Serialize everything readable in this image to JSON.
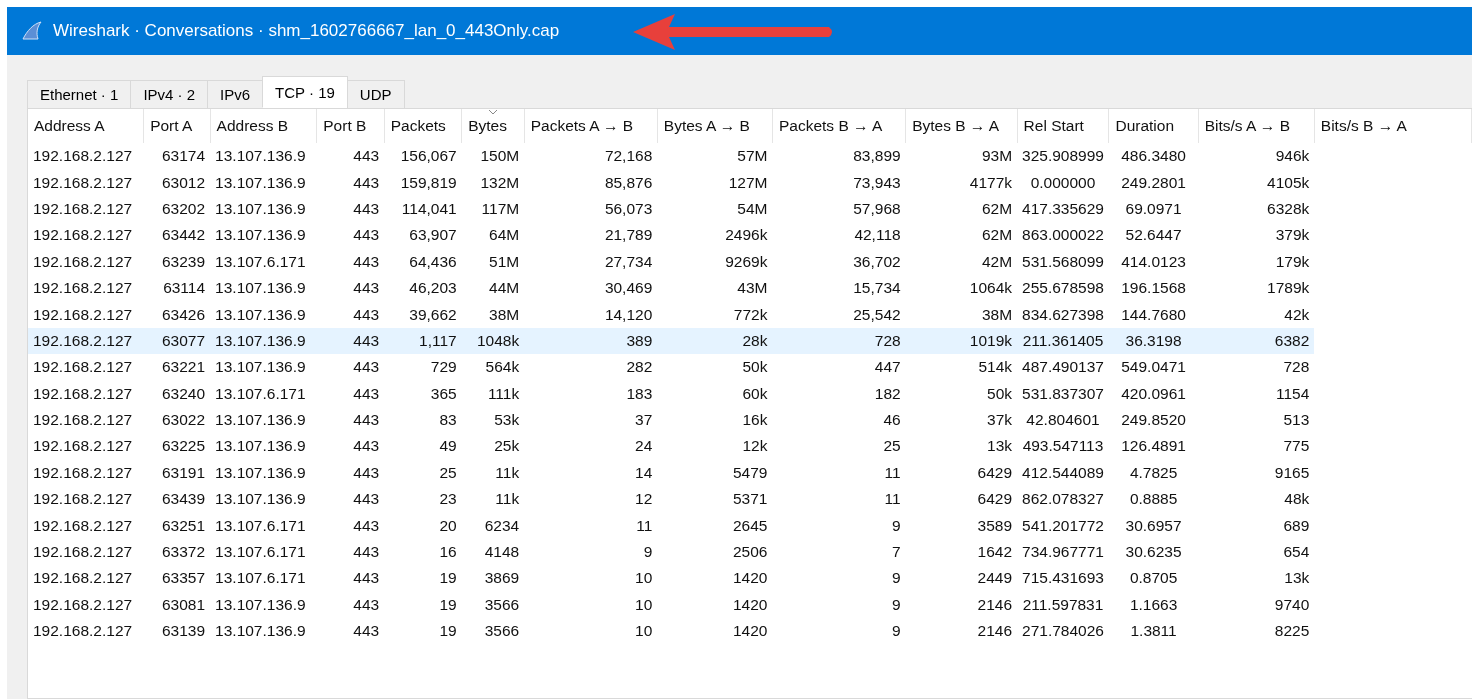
{
  "window": {
    "title": "Wireshark · Conversations · shm_1602766667_lan_0_443Only.cap"
  },
  "tabs": [
    {
      "label": "Ethernet · 1",
      "selected": false
    },
    {
      "label": "IPv4 · 2",
      "selected": false
    },
    {
      "label": "IPv6",
      "selected": false
    },
    {
      "label": "TCP · 19",
      "selected": true
    },
    {
      "label": "UDP",
      "selected": false
    }
  ],
  "table": {
    "columns": [
      {
        "label": "Address A",
        "sorted": false,
        "kind": "address"
      },
      {
        "label": "Port A",
        "sorted": false,
        "kind": "number"
      },
      {
        "label": "Address B",
        "sorted": false,
        "kind": "address"
      },
      {
        "label": "Port B",
        "sorted": false,
        "kind": "number"
      },
      {
        "label": "Packets",
        "sorted": false,
        "kind": "number"
      },
      {
        "label": "Bytes",
        "sorted": true,
        "kind": "number"
      },
      {
        "label": "Packets A → B",
        "sorted": false,
        "kind": "number"
      },
      {
        "label": "Bytes A → B",
        "sorted": false,
        "kind": "number"
      },
      {
        "label": "Packets B → A",
        "sorted": false,
        "kind": "number"
      },
      {
        "label": "Bytes B → A",
        "sorted": false,
        "kind": "number"
      },
      {
        "label": "Rel Start",
        "sorted": false,
        "kind": "time"
      },
      {
        "label": "Duration",
        "sorted": false,
        "kind": "time"
      },
      {
        "label": "Bits/s A → B",
        "sorted": false,
        "kind": "number"
      },
      {
        "label": "Bits/s B → A",
        "sorted": false,
        "kind": "number"
      }
    ],
    "rows": [
      {
        "highlighted": false,
        "cells": [
          "192.168.2.127",
          "63174",
          "13.107.136.9",
          "443",
          "156,067",
          "150M",
          "72,168",
          "57M",
          "83,899",
          "93M",
          "325.908999",
          "486.3480",
          "946k"
        ]
      },
      {
        "highlighted": false,
        "cells": [
          "192.168.2.127",
          "63012",
          "13.107.136.9",
          "443",
          "159,819",
          "132M",
          "85,876",
          "127M",
          "73,943",
          "4177k",
          "0.000000",
          "249.2801",
          "4105k"
        ]
      },
      {
        "highlighted": false,
        "cells": [
          "192.168.2.127",
          "63202",
          "13.107.136.9",
          "443",
          "114,041",
          "117M",
          "56,073",
          "54M",
          "57,968",
          "62M",
          "417.335629",
          "69.0971",
          "6328k"
        ]
      },
      {
        "highlighted": false,
        "cells": [
          "192.168.2.127",
          "63442",
          "13.107.136.9",
          "443",
          "63,907",
          "64M",
          "21,789",
          "2496k",
          "42,118",
          "62M",
          "863.000022",
          "52.6447",
          "379k"
        ]
      },
      {
        "highlighted": false,
        "cells": [
          "192.168.2.127",
          "63239",
          "13.107.6.171",
          "443",
          "64,436",
          "51M",
          "27,734",
          "9269k",
          "36,702",
          "42M",
          "531.568099",
          "414.0123",
          "179k"
        ]
      },
      {
        "highlighted": false,
        "cells": [
          "192.168.2.127",
          "63114",
          "13.107.136.9",
          "443",
          "46,203",
          "44M",
          "30,469",
          "43M",
          "15,734",
          "1064k",
          "255.678598",
          "196.1568",
          "1789k"
        ]
      },
      {
        "highlighted": false,
        "cells": [
          "192.168.2.127",
          "63426",
          "13.107.136.9",
          "443",
          "39,662",
          "38M",
          "14,120",
          "772k",
          "25,542",
          "38M",
          "834.627398",
          "144.7680",
          "42k"
        ]
      },
      {
        "highlighted": true,
        "cells": [
          "192.168.2.127",
          "63077",
          "13.107.136.9",
          "443",
          "1,117",
          "1048k",
          "389",
          "28k",
          "728",
          "1019k",
          "211.361405",
          "36.3198",
          "6382"
        ]
      },
      {
        "highlighted": false,
        "cells": [
          "192.168.2.127",
          "63221",
          "13.107.136.9",
          "443",
          "729",
          "564k",
          "282",
          "50k",
          "447",
          "514k",
          "487.490137",
          "549.0471",
          "728"
        ]
      },
      {
        "highlighted": false,
        "cells": [
          "192.168.2.127",
          "63240",
          "13.107.6.171",
          "443",
          "365",
          "111k",
          "183",
          "60k",
          "182",
          "50k",
          "531.837307",
          "420.0961",
          "1154"
        ]
      },
      {
        "highlighted": false,
        "cells": [
          "192.168.2.127",
          "63022",
          "13.107.136.9",
          "443",
          "83",
          "53k",
          "37",
          "16k",
          "46",
          "37k",
          "42.804601",
          "249.8520",
          "513"
        ]
      },
      {
        "highlighted": false,
        "cells": [
          "192.168.2.127",
          "63225",
          "13.107.136.9",
          "443",
          "49",
          "25k",
          "24",
          "12k",
          "25",
          "13k",
          "493.547113",
          "126.4891",
          "775"
        ]
      },
      {
        "highlighted": false,
        "cells": [
          "192.168.2.127",
          "63191",
          "13.107.136.9",
          "443",
          "25",
          "11k",
          "14",
          "5479",
          "11",
          "6429",
          "412.544089",
          "4.7825",
          "9165"
        ]
      },
      {
        "highlighted": false,
        "cells": [
          "192.168.2.127",
          "63439",
          "13.107.136.9",
          "443",
          "23",
          "11k",
          "12",
          "5371",
          "11",
          "6429",
          "862.078327",
          "0.8885",
          "48k"
        ]
      },
      {
        "highlighted": false,
        "cells": [
          "192.168.2.127",
          "63251",
          "13.107.6.171",
          "443",
          "20",
          "6234",
          "11",
          "2645",
          "9",
          "3589",
          "541.201772",
          "30.6957",
          "689"
        ]
      },
      {
        "highlighted": false,
        "cells": [
          "192.168.2.127",
          "63372",
          "13.107.6.171",
          "443",
          "16",
          "4148",
          "9",
          "2506",
          "7",
          "1642",
          "734.967771",
          "30.6235",
          "654"
        ]
      },
      {
        "highlighted": false,
        "cells": [
          "192.168.2.127",
          "63357",
          "13.107.6.171",
          "443",
          "19",
          "3869",
          "10",
          "1420",
          "9",
          "2449",
          "715.431693",
          "0.8705",
          "13k"
        ]
      },
      {
        "highlighted": false,
        "cells": [
          "192.168.2.127",
          "63081",
          "13.107.136.9",
          "443",
          "19",
          "3566",
          "10",
          "1420",
          "9",
          "2146",
          "211.597831",
          "1.1663",
          "9740"
        ]
      },
      {
        "highlighted": false,
        "cells": [
          "192.168.2.127",
          "63139",
          "13.107.136.9",
          "443",
          "19",
          "3566",
          "10",
          "1420",
          "9",
          "2146",
          "271.784026",
          "1.3811",
          "8225"
        ]
      }
    ]
  }
}
